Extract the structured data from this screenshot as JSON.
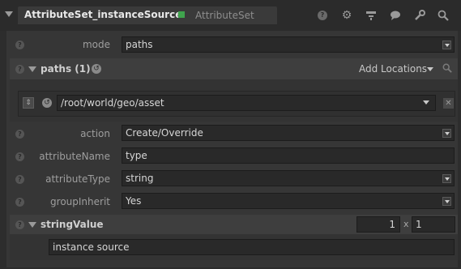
{
  "header": {
    "node_name": "AttributeSet_instanceSource",
    "node_type": "AttributeSet",
    "icons": [
      "help-icon",
      "gear-icon",
      "hierarchy-icon",
      "comment-icon",
      "wrench-icon",
      "search-icon"
    ]
  },
  "params": {
    "mode": {
      "label": "mode",
      "value": "paths"
    },
    "paths": {
      "title": "paths (1)",
      "add_locations": "Add Locations",
      "entries": [
        "/root/world/geo/asset"
      ]
    },
    "action": {
      "label": "action",
      "value": "Create/Override"
    },
    "attributeName": {
      "label": "attributeName",
      "value": "type"
    },
    "attributeType": {
      "label": "attributeType",
      "value": "string"
    },
    "groupInherit": {
      "label": "groupInherit",
      "value": "Yes"
    },
    "stringValue": {
      "title": "stringValue",
      "rows": "1",
      "times": "x",
      "cols": "1",
      "value": "instance source"
    }
  },
  "colors": {
    "background": "#2d2d2d",
    "panel": "#363636",
    "accent_green": "#3fa34d"
  }
}
